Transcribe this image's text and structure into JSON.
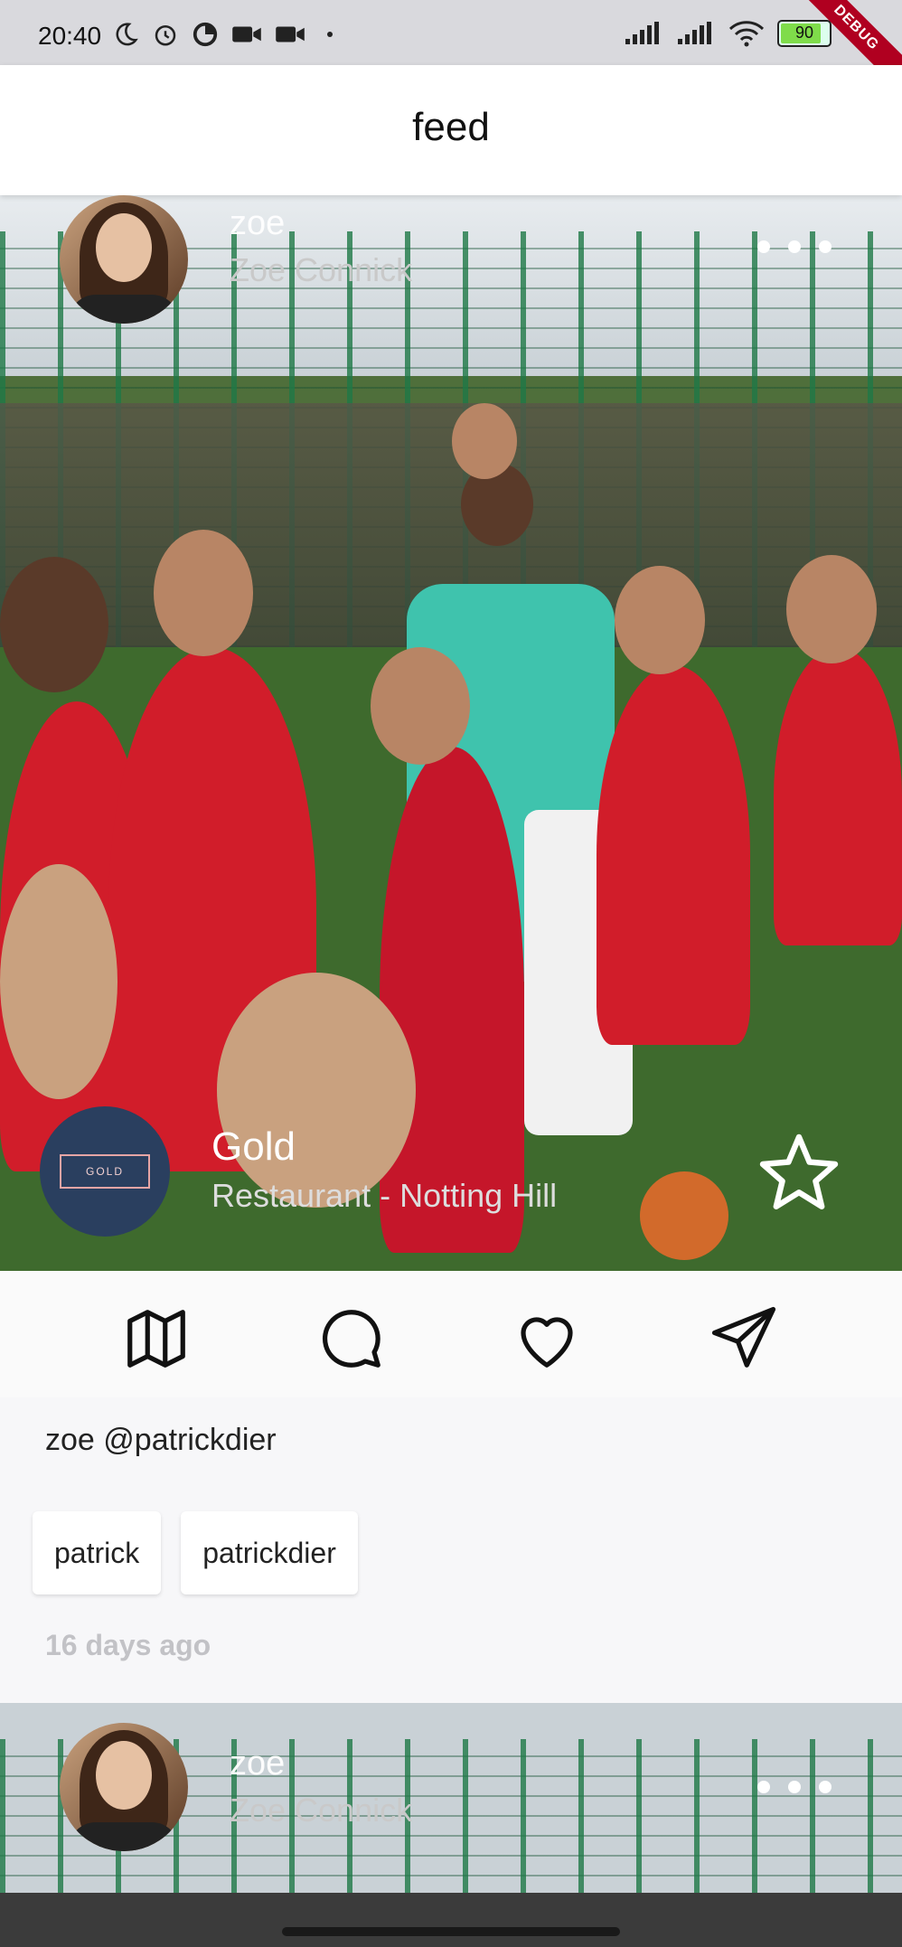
{
  "status_bar": {
    "time": "20:40",
    "battery": "90",
    "left_icons": [
      "moon-icon",
      "alarm-icon",
      "data-saver-icon",
      "video-icon",
      "video-icon-2",
      "dot-icon"
    ],
    "right_icons": [
      "signal-icon",
      "signal-icon-2",
      "wifi-icon",
      "battery-icon"
    ],
    "debug_label": "DEBUG"
  },
  "appbar": {
    "title": "feed"
  },
  "post": {
    "username": "zoe",
    "full_name": "Zoe Connick",
    "venue_name": "Gold",
    "venue_subtitle": "Restaurant - Notting Hill",
    "venue_logo_text": "GOLD",
    "caption": "zoe @patrickdier",
    "tags": [
      "patrick",
      "patrickdier"
    ],
    "time_ago": "16 days ago",
    "actions": [
      "map-icon",
      "comment-icon",
      "heart-icon",
      "send-icon"
    ]
  },
  "post2": {
    "username": "zoe",
    "full_name": "Zoe Connick"
  },
  "colors": {
    "appbar_bg": "#ffffff",
    "background": "#f7f7f9",
    "accent_red": "#d11d2a"
  }
}
